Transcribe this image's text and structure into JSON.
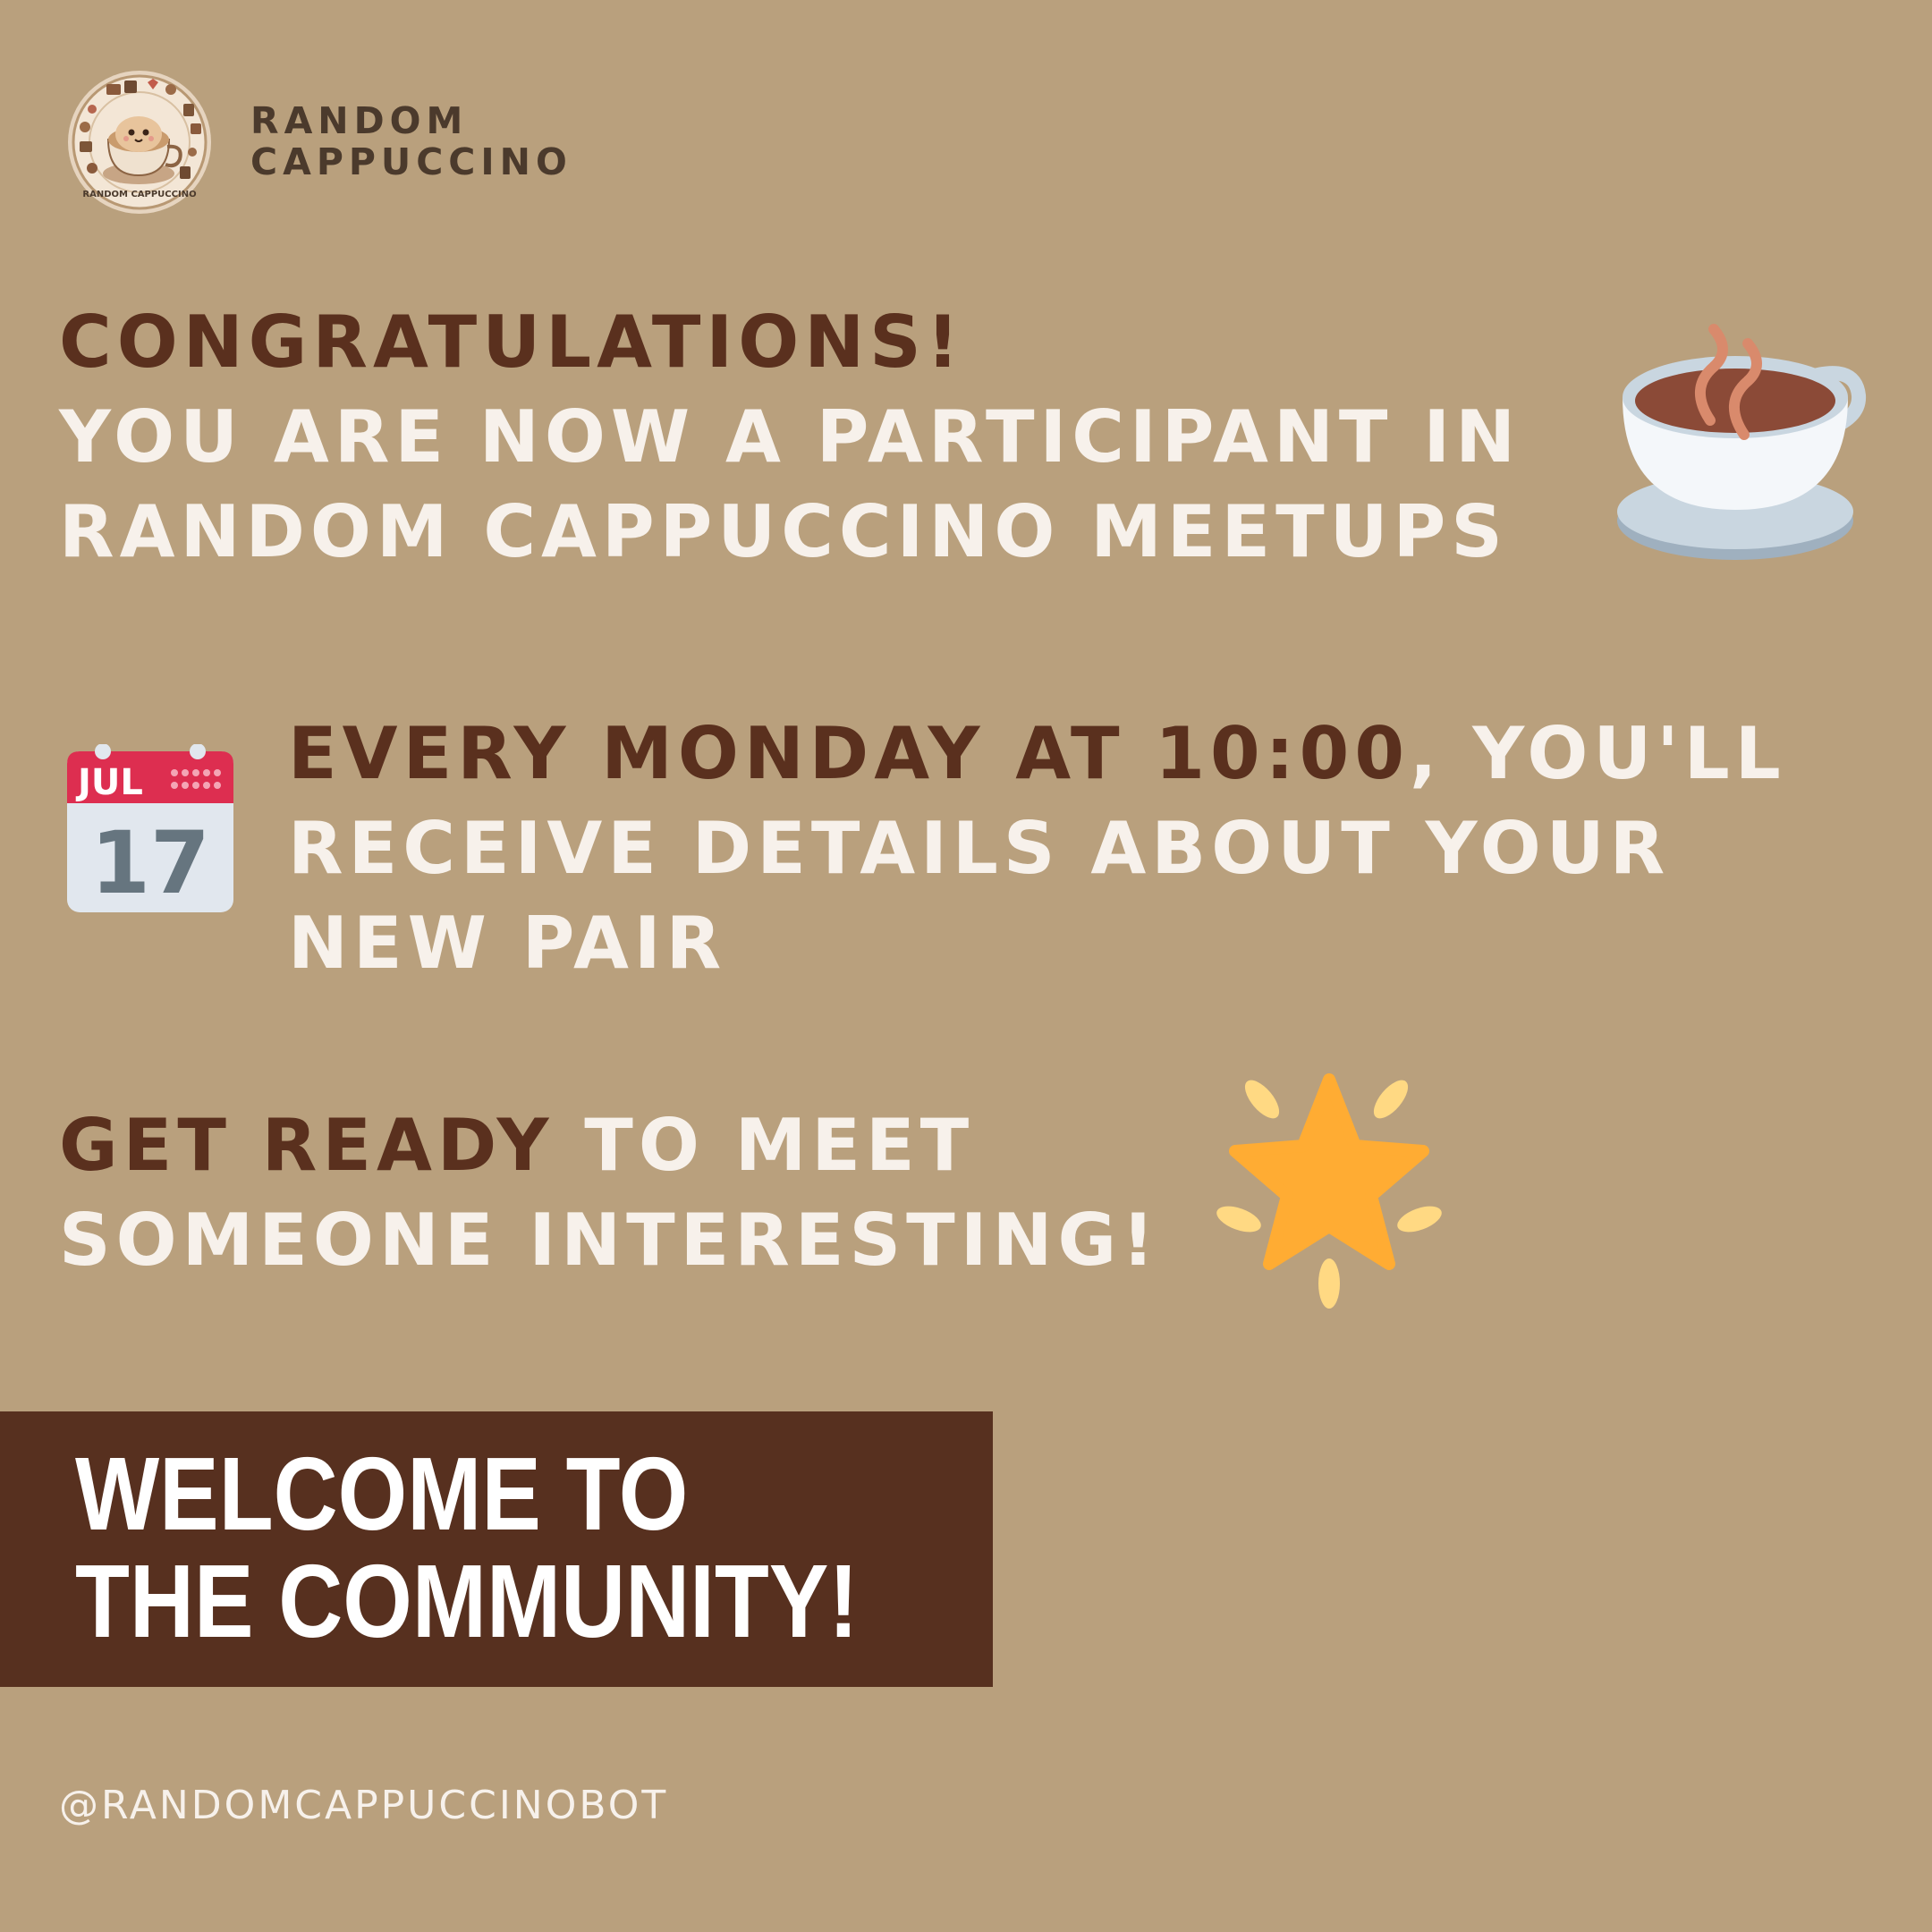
{
  "brand": {
    "line1": "RANDOM",
    "line2": "CAPPUCCINO",
    "logo_icon": "latte-mascot-logo-icon",
    "logo_ring_text": "RANDOM CAPPUCCINO"
  },
  "congrats": {
    "line1": "CONGRATULATIONS!",
    "line2": "YOU ARE NOW A PARTICIPANT IN",
    "line3": "RANDOM CAPPUCCINO MEETUPS",
    "icon": "hot-beverage-icon"
  },
  "schedule": {
    "line1_dark": "EVERY MONDAY AT 10:00",
    "line1_light": ", YOU'LL",
    "line2": "RECEIVE DETAILS ABOUT YOUR",
    "line3": "NEW PAIR",
    "icon": "calendar-icon",
    "calendar_month": "JUL",
    "calendar_day": "17"
  },
  "ready": {
    "line1_dark": "GET READY",
    "line1_light": " TO MEET",
    "line2": "SOMEONE INTERESTING!",
    "icon": "glowing-star-icon"
  },
  "welcome": {
    "line1": "WELCOME TO",
    "line2": "THE COMMUNITY!"
  },
  "footer": {
    "handle": "@RANDOMCAPPUCCINOBOT"
  },
  "colors": {
    "background": "#b9a07d",
    "dark_text": "#5a301e",
    "light_text": "#f7f1eb",
    "banner": "#57301f"
  }
}
